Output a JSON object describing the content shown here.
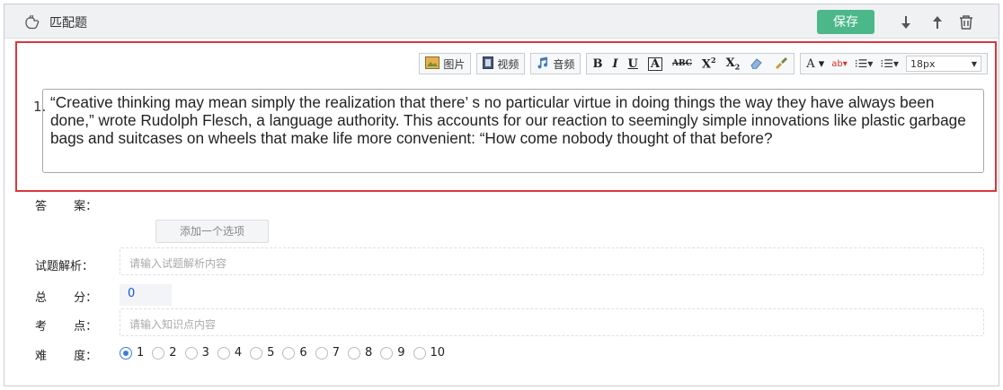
{
  "header": {
    "title": "匹配题",
    "save_label": "保存"
  },
  "toolbar": {
    "image_label": "图片",
    "video_label": "视频",
    "audio_label": "音频",
    "font_size": "18px"
  },
  "question": {
    "number": "1.",
    "text": "“Creative thinking may mean simply the realization that there’  s no particular virtue in doing things the way they have always been done,”  wrote Rudolph Flesch, a language authority. This accounts for our reaction to seemingly simple innovations like plastic garbage bags and suitcases on wheels that make life more convenient:  “How come nobody thought of that before?"
  },
  "form": {
    "answer_label": "答 案：",
    "add_option_label": "添加一个选项",
    "analysis_label": "试题解析：",
    "analysis_placeholder": "请输入试题解析内容",
    "score_label": "总 分：",
    "score_value": "0",
    "knowledge_label": "考 点：",
    "knowledge_placeholder": "请输入知识点内容",
    "difficulty_label": "难 度：",
    "difficulty_options": [
      "1",
      "2",
      "3",
      "4",
      "5",
      "6",
      "7",
      "8",
      "9",
      "10"
    ],
    "difficulty_selected": "1"
  },
  "colors": {
    "save": "#4cb88a",
    "editor_border": "#d9363e",
    "radio_active": "#3b7de0",
    "score_text": "#1a55d6"
  }
}
